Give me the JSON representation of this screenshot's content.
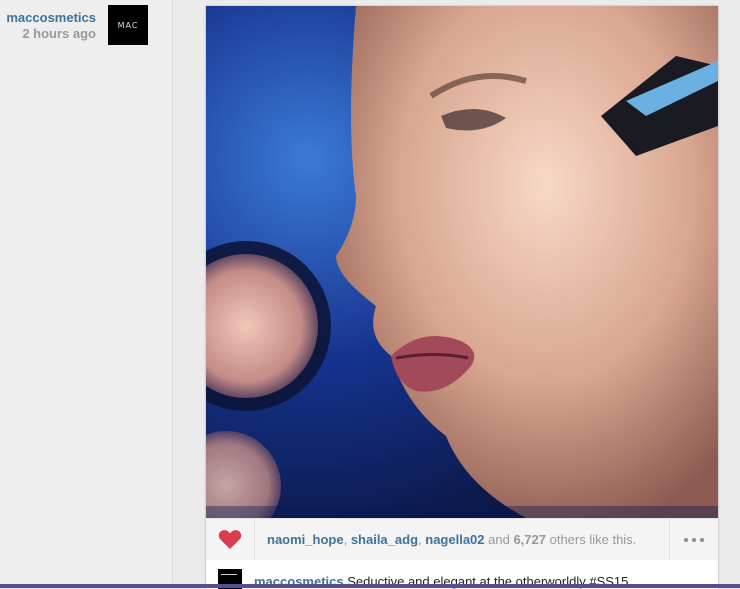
{
  "post": {
    "username": "maccosmetics",
    "time_ago": "2 hours ago",
    "avatar_text": "MAC",
    "image_alt": "Close-up of a model's face with a makeup brush applying highlighter"
  },
  "likes": {
    "names": [
      "naomi_hope",
      "shaila_adg",
      "nagella02"
    ],
    "sep1": ", ",
    "sep2": ", ",
    "and_text": " and ",
    "count": "6,727",
    "suffix": " others like this."
  },
  "caption": {
    "username": "maccosmetics",
    "text": "Seductive and elegant at the otherworldly #SS15"
  },
  "icons": {
    "like": "heart-icon",
    "more": "more-options-icon"
  },
  "colors": {
    "link": "#3f729b",
    "heart": "#d83c4e"
  }
}
